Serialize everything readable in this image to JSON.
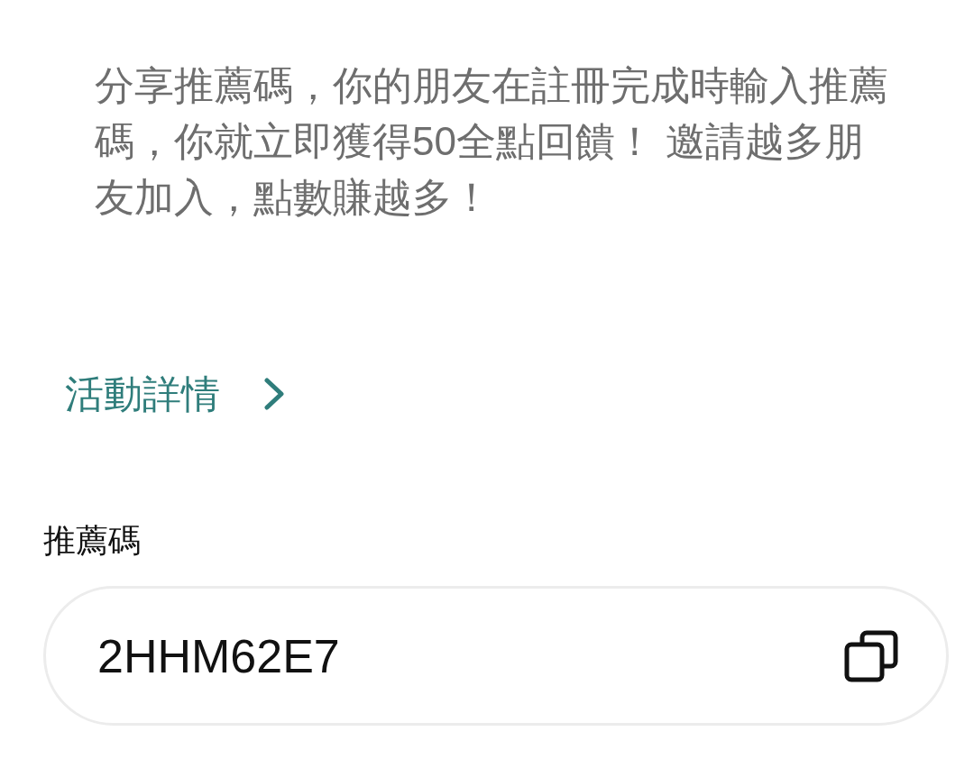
{
  "description": "分享推薦碼，你的朋友在註冊完成時輸入推薦碼，你就立即獲得50全點回饋！ 邀請越多朋友加入，點數賺越多！",
  "details_link": {
    "label": "活動詳情"
  },
  "referral_code": {
    "label": "推薦碼",
    "value": "2HHM62E7"
  }
}
